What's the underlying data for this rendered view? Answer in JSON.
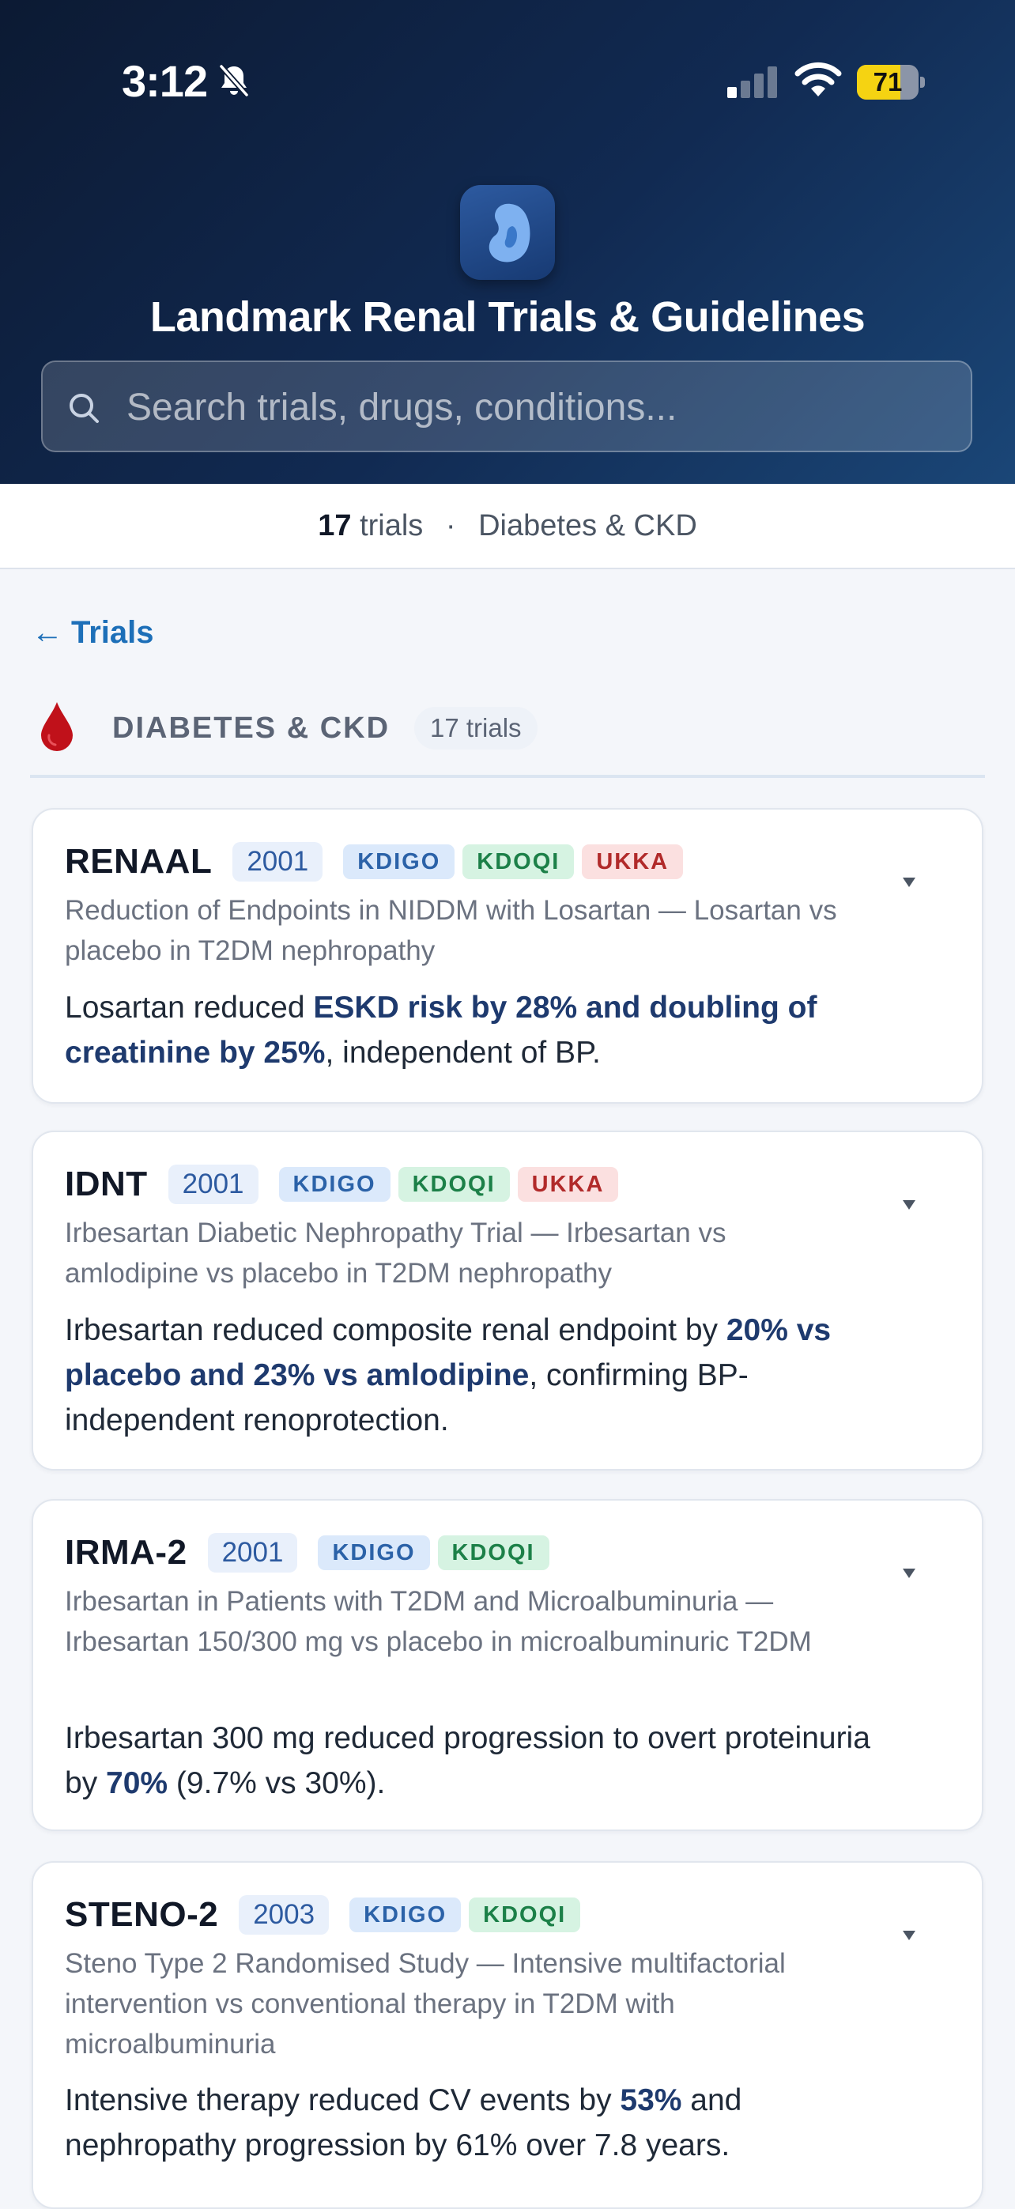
{
  "status": {
    "time": "3:12",
    "battery": "71",
    "battery_fraction": 0.71
  },
  "header": {
    "title": "Landmark Renal Trials & Guidelines",
    "search_placeholder": "Search trials, drugs, conditions..."
  },
  "stats": {
    "count": "17",
    "count_label": "trials",
    "separator": "·",
    "category": "Diabetes & CKD"
  },
  "nav": {
    "back_arrow": "←",
    "back_label": "Trials"
  },
  "section": {
    "title": "DIABETES & CKD",
    "count": "17 trials"
  },
  "trials": [
    {
      "name": "RENAAL",
      "year": "2001",
      "tags": [
        "KDIGO",
        "KDOQI",
        "UKKA"
      ],
      "subtitle": "Reduction of Endpoints in NIDDM with Losartan — Losartan vs placebo in T2DM nephropathy",
      "summary_parts": [
        {
          "text": "Losartan reduced ",
          "hl": false
        },
        {
          "text": "ESKD risk by 28% and doubling of creatinine by 25%",
          "hl": true
        },
        {
          "text": ", independent of BP.",
          "hl": false
        }
      ]
    },
    {
      "name": "IDNT",
      "year": "2001",
      "tags": [
        "KDIGO",
        "KDOQI",
        "UKKA"
      ],
      "subtitle": "Irbesartan Diabetic Nephropathy Trial — Irbesartan vs amlodipine vs placebo in T2DM nephropathy",
      "summary_parts": [
        {
          "text": "Irbesartan reduced composite renal endpoint by ",
          "hl": false
        },
        {
          "text": "20% vs placebo and 23% vs amlodipine",
          "hl": true
        },
        {
          "text": ", confirming BP-independent renoprotection.",
          "hl": false
        }
      ]
    },
    {
      "name": "IRMA-2",
      "year": "2001",
      "tags": [
        "KDIGO",
        "KDOQI"
      ],
      "subtitle": "Irbesartan in Patients with T2DM and Microalbuminuria — Irbesartan 150/300 mg vs placebo in microalbuminuric T2DM",
      "summary_parts": [
        {
          "text": "Irbesartan 300 mg reduced progression to overt proteinuria by ",
          "hl": false
        },
        {
          "text": "70%",
          "hl": true
        },
        {
          "text": " (9.7% vs 30%).",
          "hl": false
        }
      ]
    },
    {
      "name": "STENO-2",
      "year": "2003",
      "tags": [
        "KDIGO",
        "KDOQI"
      ],
      "subtitle": "Steno Type 2 Randomised Study — Intensive multifactorial intervention vs conventional therapy in T2DM with microalbuminuria",
      "summary_parts": [
        {
          "text": "Intensive therapy reduced CV events by ",
          "hl": false
        },
        {
          "text": "53%",
          "hl": true
        },
        {
          "text": " and nephropathy progression by 61% over 7.8 years.",
          "hl": false
        }
      ]
    }
  ],
  "colors": {
    "header_dark": "#0c1a33",
    "header_light": "#1a4677",
    "accent_link": "#1d6fb8",
    "highlight": "#1e3a6e",
    "kdigo": "#2b62a8",
    "kdoqi": "#1c8048",
    "ukka": "#b12a2a",
    "drop": "#c0111a"
  },
  "icons": {
    "status_bell": "bell-slash-icon",
    "status_signal": "cellular-signal-icon",
    "status_wifi": "wifi-icon",
    "logo": "kidney-icon",
    "search": "search-icon",
    "section": "blood-drop-icon",
    "expand": "chevron-down-icon"
  }
}
